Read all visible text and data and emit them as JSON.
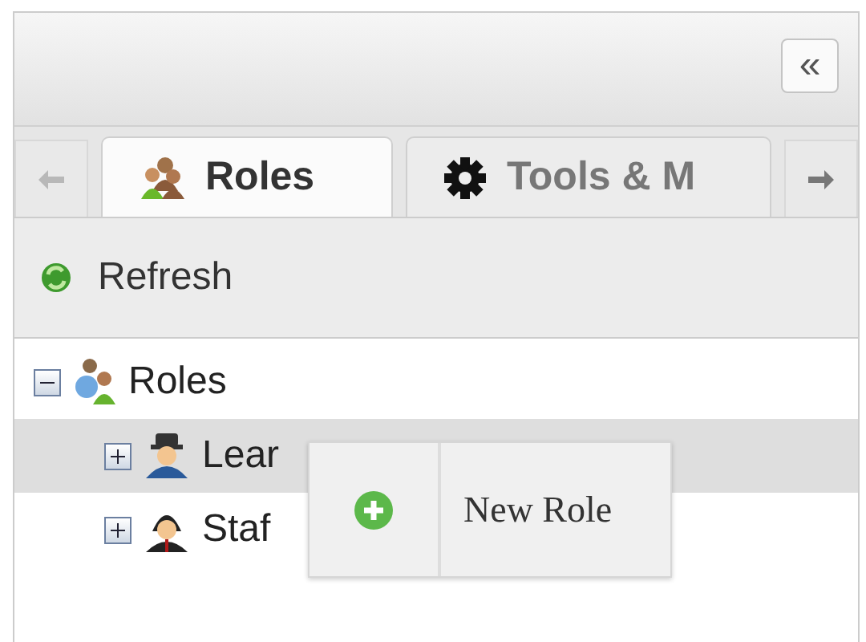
{
  "panel": {
    "collapse_button": "«"
  },
  "tabs": [
    {
      "label": "Roles",
      "kind": "people",
      "selected": true
    },
    {
      "label": "Tools & M",
      "kind": "gear",
      "selected": false
    }
  ],
  "toolbar": {
    "refresh": "Refresh"
  },
  "tree": [
    {
      "label": "Roles",
      "expanded": true,
      "selected": false,
      "children": [
        {
          "label": "Lear",
          "kind": "hat",
          "expanded": false,
          "selected": true
        },
        {
          "label": "Staf",
          "kind": "cloak",
          "expanded": false,
          "selected": false
        }
      ]
    }
  ],
  "context_menu": {
    "items": [
      {
        "label": "New Role"
      }
    ]
  }
}
